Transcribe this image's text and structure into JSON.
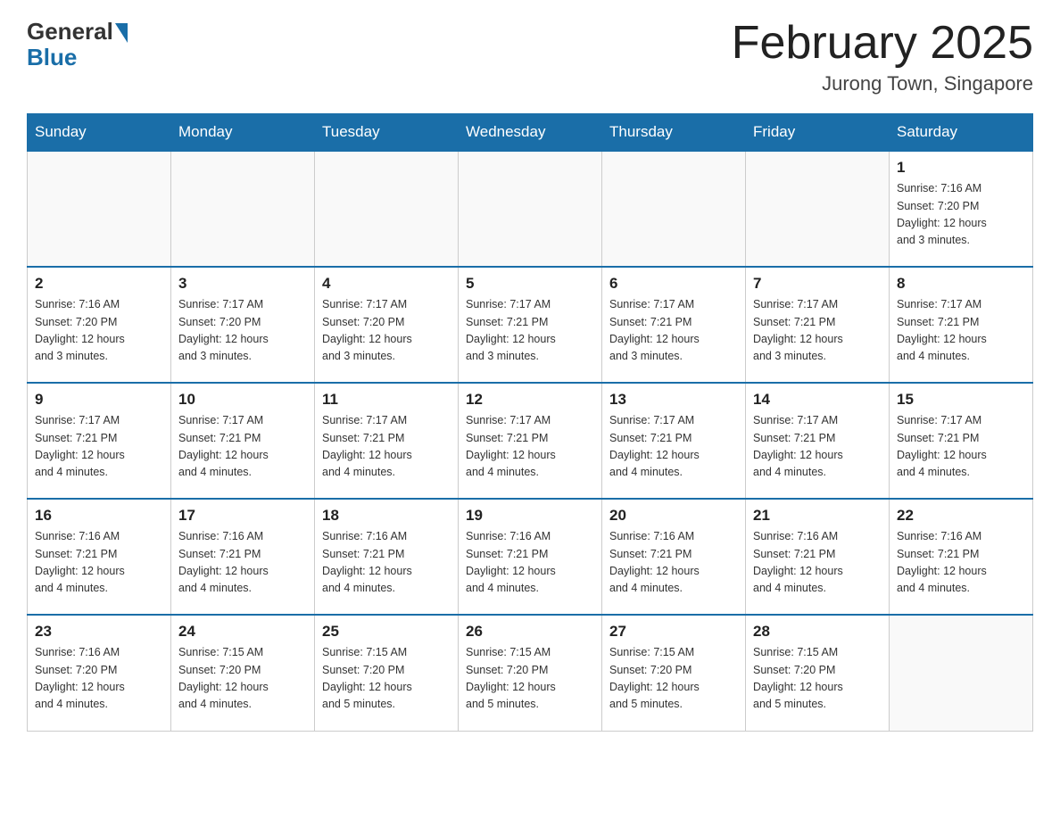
{
  "header": {
    "logo_general": "General",
    "logo_blue": "Blue",
    "month_title": "February 2025",
    "location": "Jurong Town, Singapore"
  },
  "days_of_week": [
    "Sunday",
    "Monday",
    "Tuesday",
    "Wednesday",
    "Thursday",
    "Friday",
    "Saturday"
  ],
  "weeks": [
    [
      {
        "day": "",
        "info": ""
      },
      {
        "day": "",
        "info": ""
      },
      {
        "day": "",
        "info": ""
      },
      {
        "day": "",
        "info": ""
      },
      {
        "day": "",
        "info": ""
      },
      {
        "day": "",
        "info": ""
      },
      {
        "day": "1",
        "info": "Sunrise: 7:16 AM\nSunset: 7:20 PM\nDaylight: 12 hours\nand 3 minutes."
      }
    ],
    [
      {
        "day": "2",
        "info": "Sunrise: 7:16 AM\nSunset: 7:20 PM\nDaylight: 12 hours\nand 3 minutes."
      },
      {
        "day": "3",
        "info": "Sunrise: 7:17 AM\nSunset: 7:20 PM\nDaylight: 12 hours\nand 3 minutes."
      },
      {
        "day": "4",
        "info": "Sunrise: 7:17 AM\nSunset: 7:20 PM\nDaylight: 12 hours\nand 3 minutes."
      },
      {
        "day": "5",
        "info": "Sunrise: 7:17 AM\nSunset: 7:21 PM\nDaylight: 12 hours\nand 3 minutes."
      },
      {
        "day": "6",
        "info": "Sunrise: 7:17 AM\nSunset: 7:21 PM\nDaylight: 12 hours\nand 3 minutes."
      },
      {
        "day": "7",
        "info": "Sunrise: 7:17 AM\nSunset: 7:21 PM\nDaylight: 12 hours\nand 3 minutes."
      },
      {
        "day": "8",
        "info": "Sunrise: 7:17 AM\nSunset: 7:21 PM\nDaylight: 12 hours\nand 4 minutes."
      }
    ],
    [
      {
        "day": "9",
        "info": "Sunrise: 7:17 AM\nSunset: 7:21 PM\nDaylight: 12 hours\nand 4 minutes."
      },
      {
        "day": "10",
        "info": "Sunrise: 7:17 AM\nSunset: 7:21 PM\nDaylight: 12 hours\nand 4 minutes."
      },
      {
        "day": "11",
        "info": "Sunrise: 7:17 AM\nSunset: 7:21 PM\nDaylight: 12 hours\nand 4 minutes."
      },
      {
        "day": "12",
        "info": "Sunrise: 7:17 AM\nSunset: 7:21 PM\nDaylight: 12 hours\nand 4 minutes."
      },
      {
        "day": "13",
        "info": "Sunrise: 7:17 AM\nSunset: 7:21 PM\nDaylight: 12 hours\nand 4 minutes."
      },
      {
        "day": "14",
        "info": "Sunrise: 7:17 AM\nSunset: 7:21 PM\nDaylight: 12 hours\nand 4 minutes."
      },
      {
        "day": "15",
        "info": "Sunrise: 7:17 AM\nSunset: 7:21 PM\nDaylight: 12 hours\nand 4 minutes."
      }
    ],
    [
      {
        "day": "16",
        "info": "Sunrise: 7:16 AM\nSunset: 7:21 PM\nDaylight: 12 hours\nand 4 minutes."
      },
      {
        "day": "17",
        "info": "Sunrise: 7:16 AM\nSunset: 7:21 PM\nDaylight: 12 hours\nand 4 minutes."
      },
      {
        "day": "18",
        "info": "Sunrise: 7:16 AM\nSunset: 7:21 PM\nDaylight: 12 hours\nand 4 minutes."
      },
      {
        "day": "19",
        "info": "Sunrise: 7:16 AM\nSunset: 7:21 PM\nDaylight: 12 hours\nand 4 minutes."
      },
      {
        "day": "20",
        "info": "Sunrise: 7:16 AM\nSunset: 7:21 PM\nDaylight: 12 hours\nand 4 minutes."
      },
      {
        "day": "21",
        "info": "Sunrise: 7:16 AM\nSunset: 7:21 PM\nDaylight: 12 hours\nand 4 minutes."
      },
      {
        "day": "22",
        "info": "Sunrise: 7:16 AM\nSunset: 7:21 PM\nDaylight: 12 hours\nand 4 minutes."
      }
    ],
    [
      {
        "day": "23",
        "info": "Sunrise: 7:16 AM\nSunset: 7:20 PM\nDaylight: 12 hours\nand 4 minutes."
      },
      {
        "day": "24",
        "info": "Sunrise: 7:15 AM\nSunset: 7:20 PM\nDaylight: 12 hours\nand 4 minutes."
      },
      {
        "day": "25",
        "info": "Sunrise: 7:15 AM\nSunset: 7:20 PM\nDaylight: 12 hours\nand 5 minutes."
      },
      {
        "day": "26",
        "info": "Sunrise: 7:15 AM\nSunset: 7:20 PM\nDaylight: 12 hours\nand 5 minutes."
      },
      {
        "day": "27",
        "info": "Sunrise: 7:15 AM\nSunset: 7:20 PM\nDaylight: 12 hours\nand 5 minutes."
      },
      {
        "day": "28",
        "info": "Sunrise: 7:15 AM\nSunset: 7:20 PM\nDaylight: 12 hours\nand 5 minutes."
      },
      {
        "day": "",
        "info": ""
      }
    ]
  ]
}
